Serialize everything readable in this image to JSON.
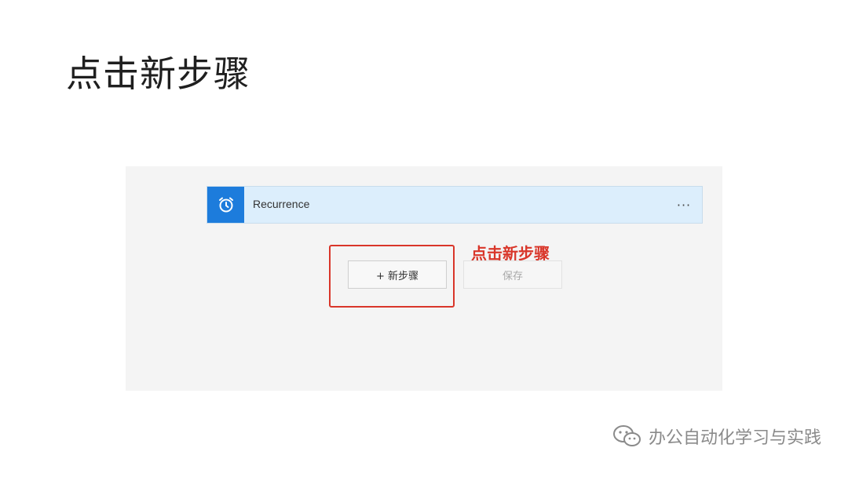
{
  "slide": {
    "title": "点击新步骤"
  },
  "flow": {
    "trigger": {
      "title": "Recurrence",
      "icon": "alarm-clock-icon",
      "more_label": "···"
    },
    "buttons": {
      "new_step_label": "+ 新步骤",
      "save_label": "保存"
    },
    "annotation": "点击新步骤"
  },
  "watermark": {
    "icon": "wechat-icon",
    "text": "办公自动化学习与实践"
  },
  "colors": {
    "accent": "#1d7cdc",
    "card": "#dceefc",
    "highlight": "#d9362a",
    "panel": "#f4f4f4"
  }
}
